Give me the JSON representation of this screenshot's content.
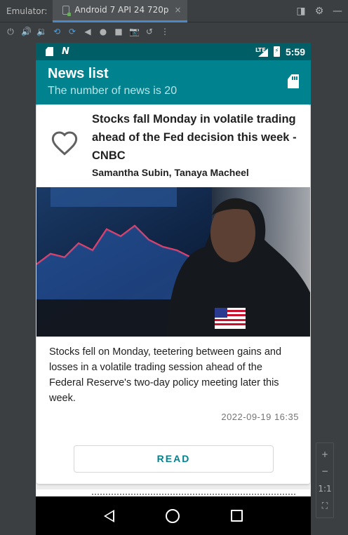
{
  "emulator": {
    "label": "Emulator:",
    "tab_title": "Android 7 API 24 720p",
    "tab_close": "×",
    "window_icons": [
      "window-mode-icon",
      "gear-icon",
      "minimize-icon"
    ],
    "toolbar_icons": [
      "power-icon",
      "volume-up-icon",
      "volume-down-icon",
      "rotate-left-icon",
      "rotate-right-icon",
      "back-icon",
      "home-icon",
      "overview-icon",
      "camera-icon",
      "replay-icon",
      "more-icon"
    ]
  },
  "status_bar": {
    "time": "5:59",
    "network": "LTE"
  },
  "app_bar": {
    "title": "News list",
    "subtitle": "The number of news is 20"
  },
  "news": [
    {
      "title": "Stocks fall Monday in volatile trading ahead of the Fed decision this week - CNBC",
      "authors": "Samantha Subin, Tanaya Macheel",
      "description": "Stocks fell on Monday, teetering between gains and losses in a volatile trading session ahead of the Federal Reserve's two-day policy meeting later this week.",
      "date": "2022-09-19 16:35",
      "read_label": "READ",
      "favorite": false
    }
  ],
  "zoom": {
    "plus": "+",
    "minus": "−",
    "ratio": "1:1"
  },
  "colors": {
    "primary": "#00838f",
    "primary_dark": "#005f66",
    "accent_text": "#00838f"
  }
}
